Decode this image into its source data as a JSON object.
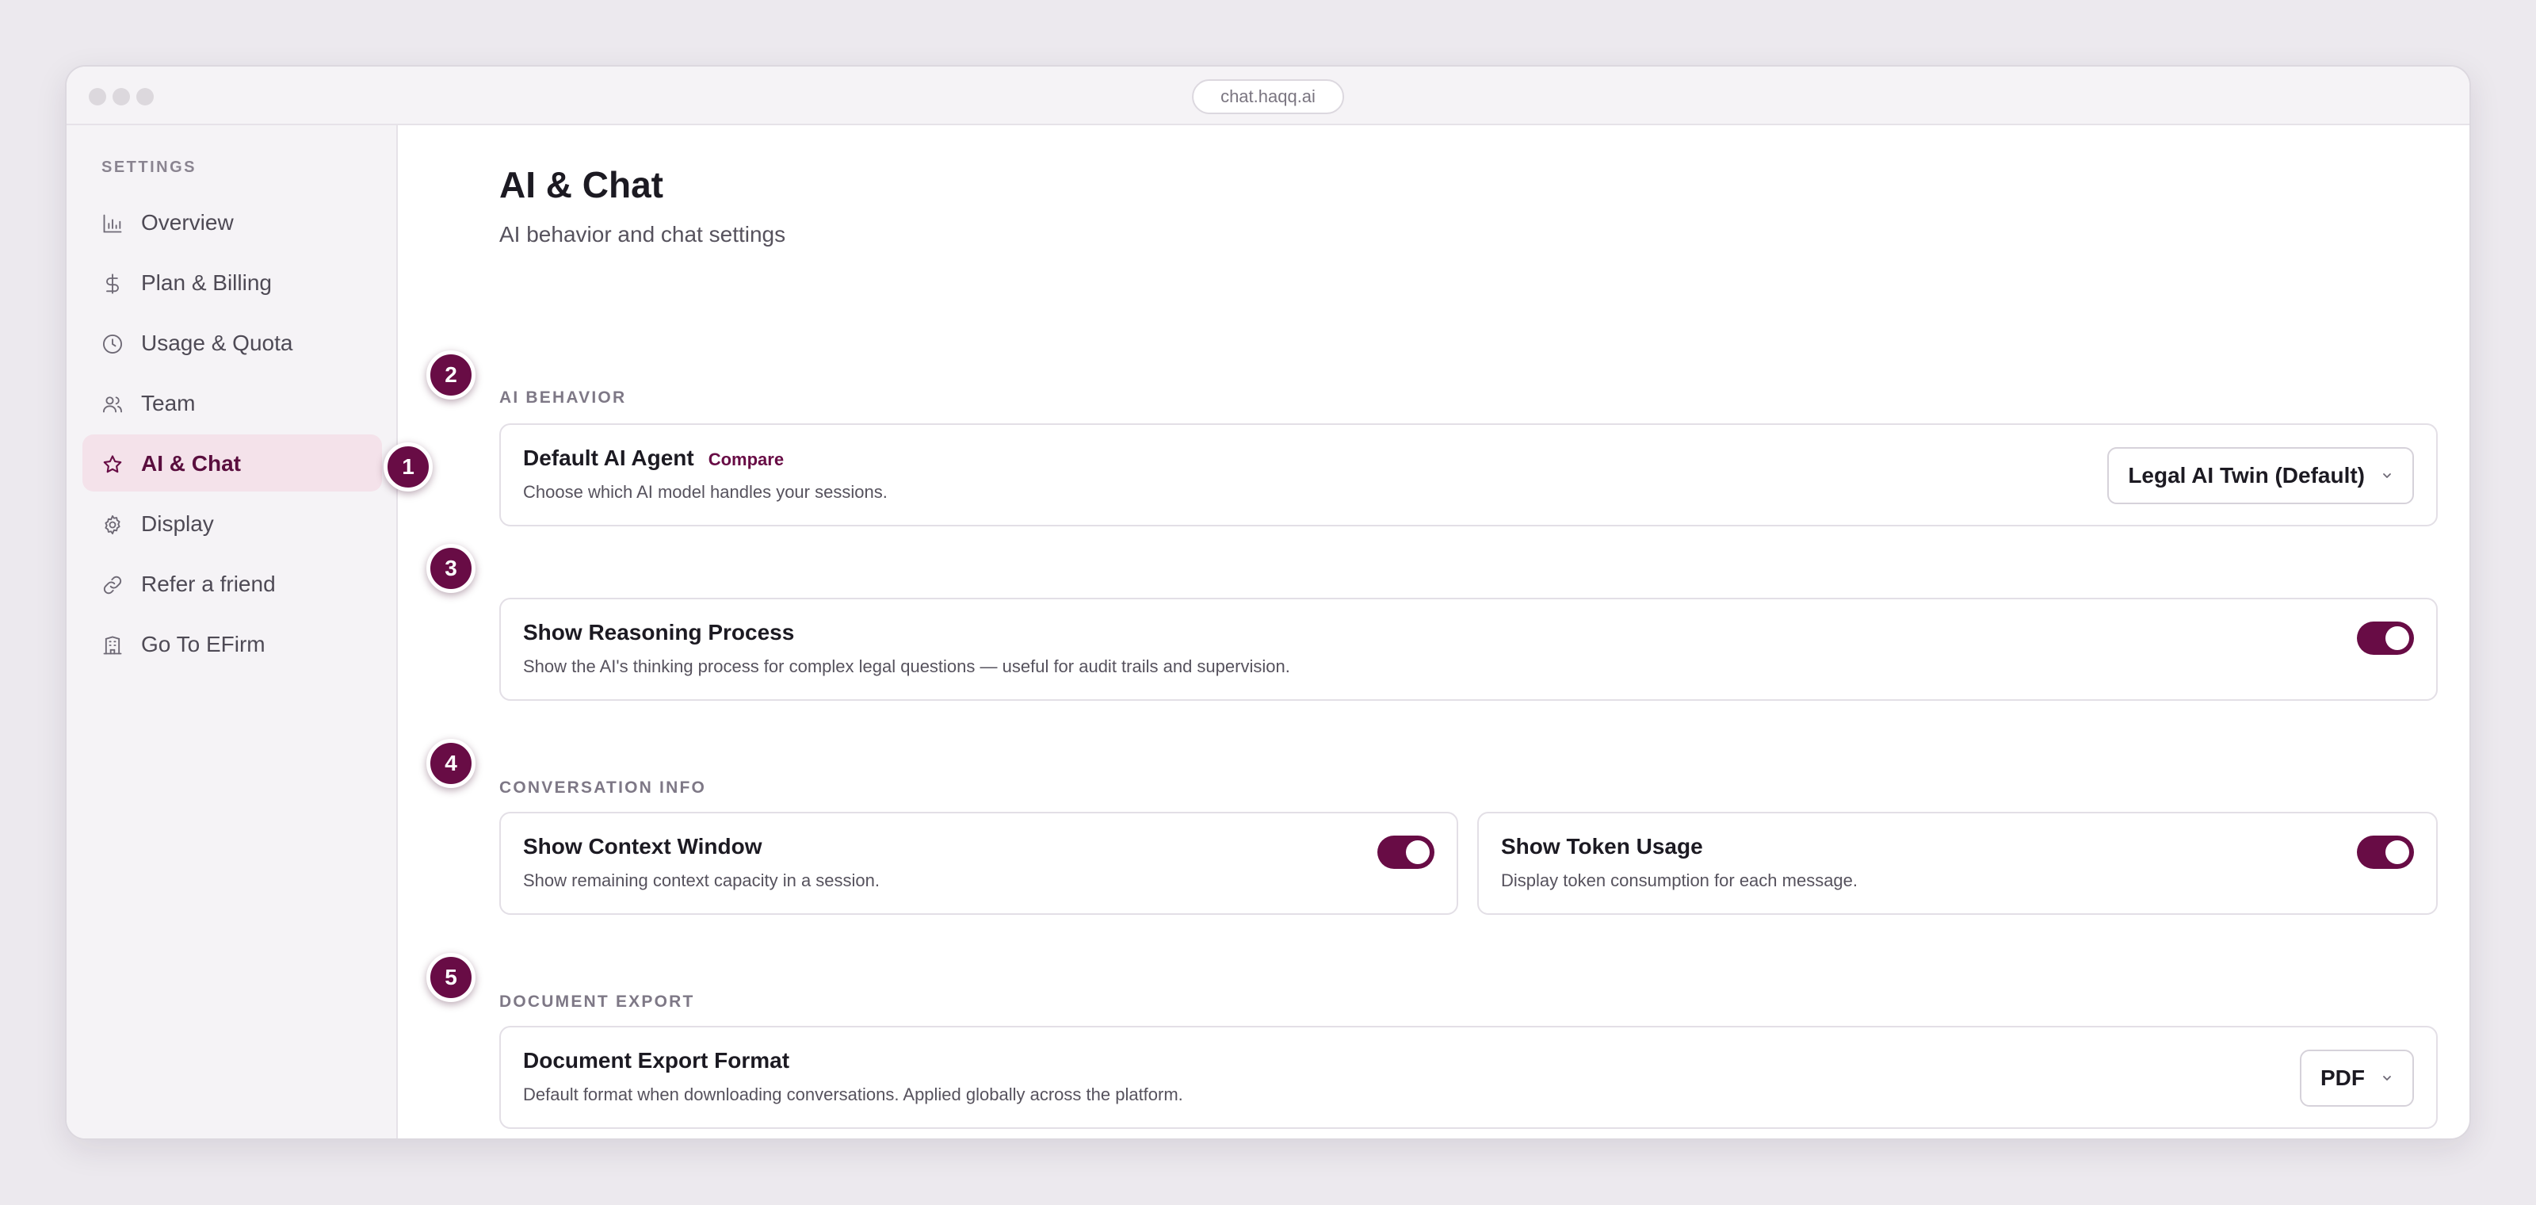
{
  "browser": {
    "url": "chat.haqq.ai"
  },
  "colors": {
    "accent": "#680c45",
    "active_bg": "#f4e2ea",
    "background": "#ece9ee"
  },
  "sidebar": {
    "heading": "SETTINGS",
    "items": [
      {
        "label": "Overview",
        "icon": "bar-chart-icon"
      },
      {
        "label": "Plan & Billing",
        "icon": "dollar-icon"
      },
      {
        "label": "Usage & Quota",
        "icon": "clock-icon"
      },
      {
        "label": "Team",
        "icon": "users-icon"
      },
      {
        "label": "AI & Chat",
        "icon": "star-icon",
        "active": true
      },
      {
        "label": "Display",
        "icon": "gear-icon"
      },
      {
        "label": "Refer a friend",
        "icon": "link-icon"
      },
      {
        "label": "Go To EFirm",
        "icon": "building-icon"
      }
    ]
  },
  "markers": [
    "1",
    "2",
    "3",
    "4",
    "5"
  ],
  "page": {
    "title": "AI & Chat",
    "subtitle": "AI behavior and chat settings"
  },
  "sections": {
    "ai_behavior": {
      "heading": "AI BEHAVIOR",
      "default_agent": {
        "title": "Default AI Agent",
        "link": "Compare",
        "description": "Choose which AI model handles your sessions.",
        "selected": "Legal AI Twin (Default)"
      },
      "reasoning": {
        "title": "Show Reasoning Process",
        "description": "Show the AI's thinking process for complex legal questions — useful for audit trails and supervision.",
        "enabled": true
      }
    },
    "conversation_info": {
      "heading": "CONVERSATION INFO",
      "context_window": {
        "title": "Show Context Window",
        "description": "Show remaining context capacity in a session.",
        "enabled": true
      },
      "token_usage": {
        "title": "Show Token Usage",
        "description": "Display token consumption for each message.",
        "enabled": true
      }
    },
    "document_export": {
      "heading": "DOCUMENT EXPORT",
      "format": {
        "title": "Document Export Format",
        "description": "Default format when downloading conversations. Applied globally across the platform.",
        "selected": "PDF"
      }
    }
  }
}
